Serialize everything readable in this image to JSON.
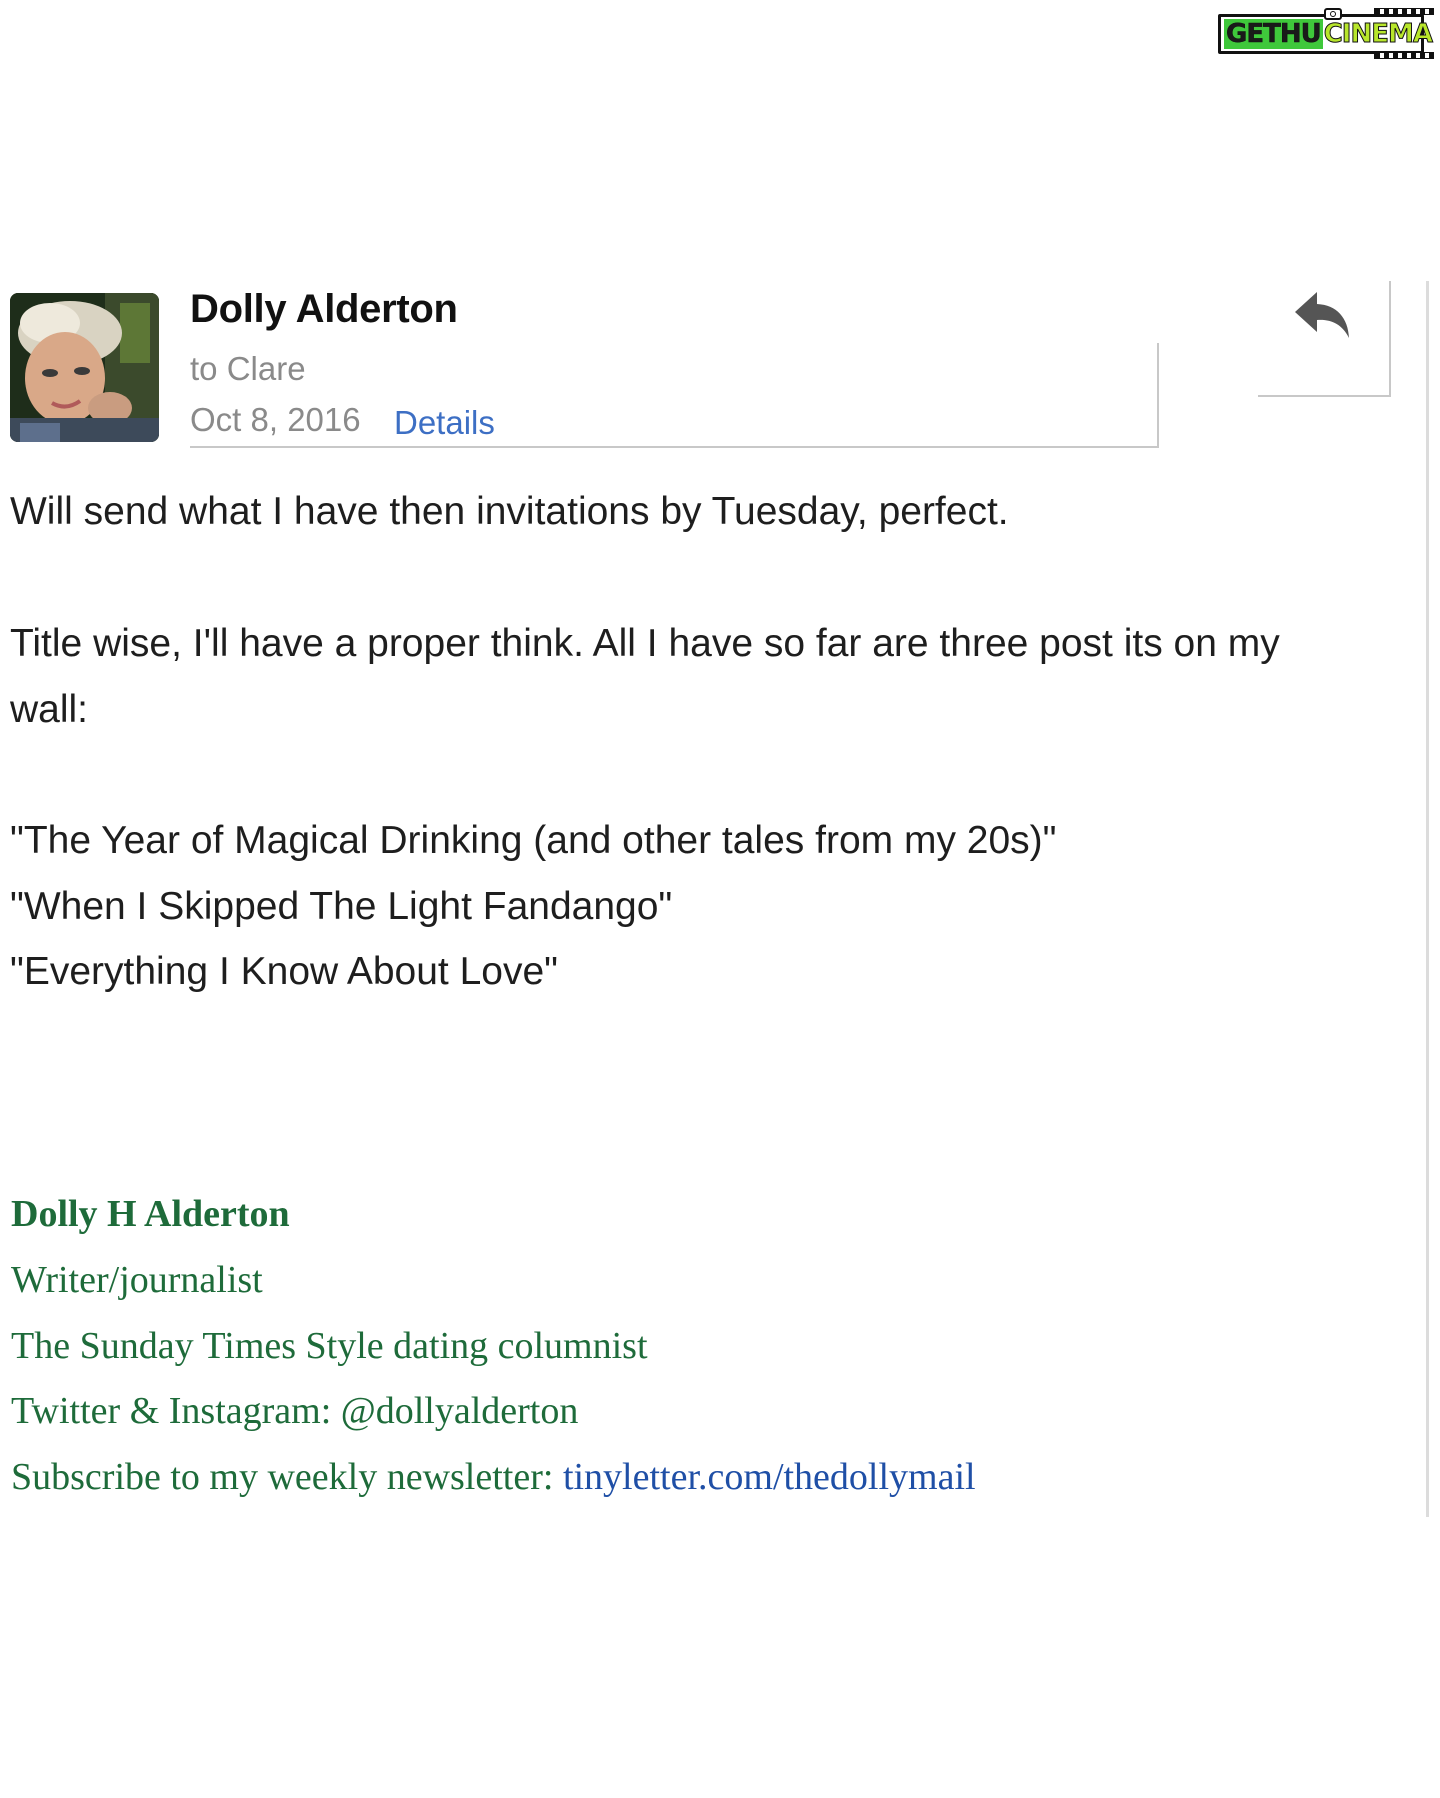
{
  "watermark": {
    "part1": "GETHU",
    "part2": "CINEMA"
  },
  "email": {
    "sender_name": "Dolly Alderton",
    "recipient": "to Clare",
    "date": "Oct 8, 2016",
    "details_label": "Details",
    "reply_icon": "reply-arrow-icon",
    "body": {
      "line1": "Will send what I have then invitations by Tuesday, perfect.",
      "line2": "Title wise, I'll have a proper think. All I have so far are three post its on my",
      "line3": "wall:",
      "titles": [
        "\"The Year of Magical Drinking (and other tales from my 20s)\"",
        "\"When I Skipped The Light Fandango\"",
        "\"Everything I Know About Love\""
      ]
    },
    "signature": {
      "name": "Dolly H Alderton",
      "role": "Writer/journalist",
      "column": "The Sunday Times Style dating columnist",
      "social": "Twitter & Instagram: @dollyalderton",
      "newsletter_prefix": "Subscribe to my weekly newsletter: ",
      "newsletter_link": "tinyletter.com/thedollymail"
    }
  },
  "colors": {
    "link": "#3d6fc4",
    "signature_green": "#1e6b3a",
    "signature_link": "#1f4fa6",
    "meta_gray": "#8a8a8a"
  }
}
